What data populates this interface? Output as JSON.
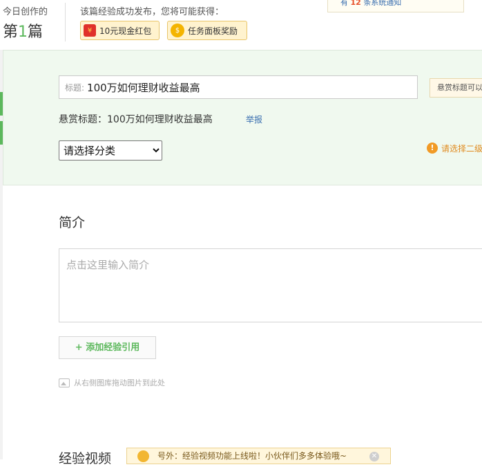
{
  "header": {
    "today_label": "今日创作的",
    "today_prefix": "第",
    "today_num": "1",
    "today_suffix": "篇",
    "reward_title": "该篇经验成功发布，您将可能获得：",
    "badges": [
      {
        "label": "10元现金红包",
        "icon": "red-envelope-icon"
      },
      {
        "label": "任务面板奖励",
        "icon": "gold-coin-icon"
      }
    ],
    "notice": {
      "prefix": "有",
      "count": "12",
      "suffix": "条系统通知"
    }
  },
  "form": {
    "title_prefix": "标题:",
    "title_value": "100万如何理财收益最高",
    "tip_bubble": "悬赏标题可以",
    "reward_label": "悬赏标题：",
    "reward_value": "100万如何理财收益最高",
    "report_link": "举报",
    "category_selected": "请选择分类",
    "category_warning": "请选择二级"
  },
  "intro": {
    "heading": "简介",
    "placeholder": "点击这里输入简介",
    "add_ref_button": "+ 添加经验引用",
    "drag_hint": "从右侧图库拖动图片到此处"
  },
  "video": {
    "heading": "经验视频",
    "tip": "号外：经验视频功能上线啦！小伙伴们多多体验哦~"
  },
  "colors": {
    "accent_green": "#5cb85c",
    "panel_bg": "#f0f9ef",
    "warning_orange": "#f19a25",
    "link_blue": "#3a6fb0"
  }
}
